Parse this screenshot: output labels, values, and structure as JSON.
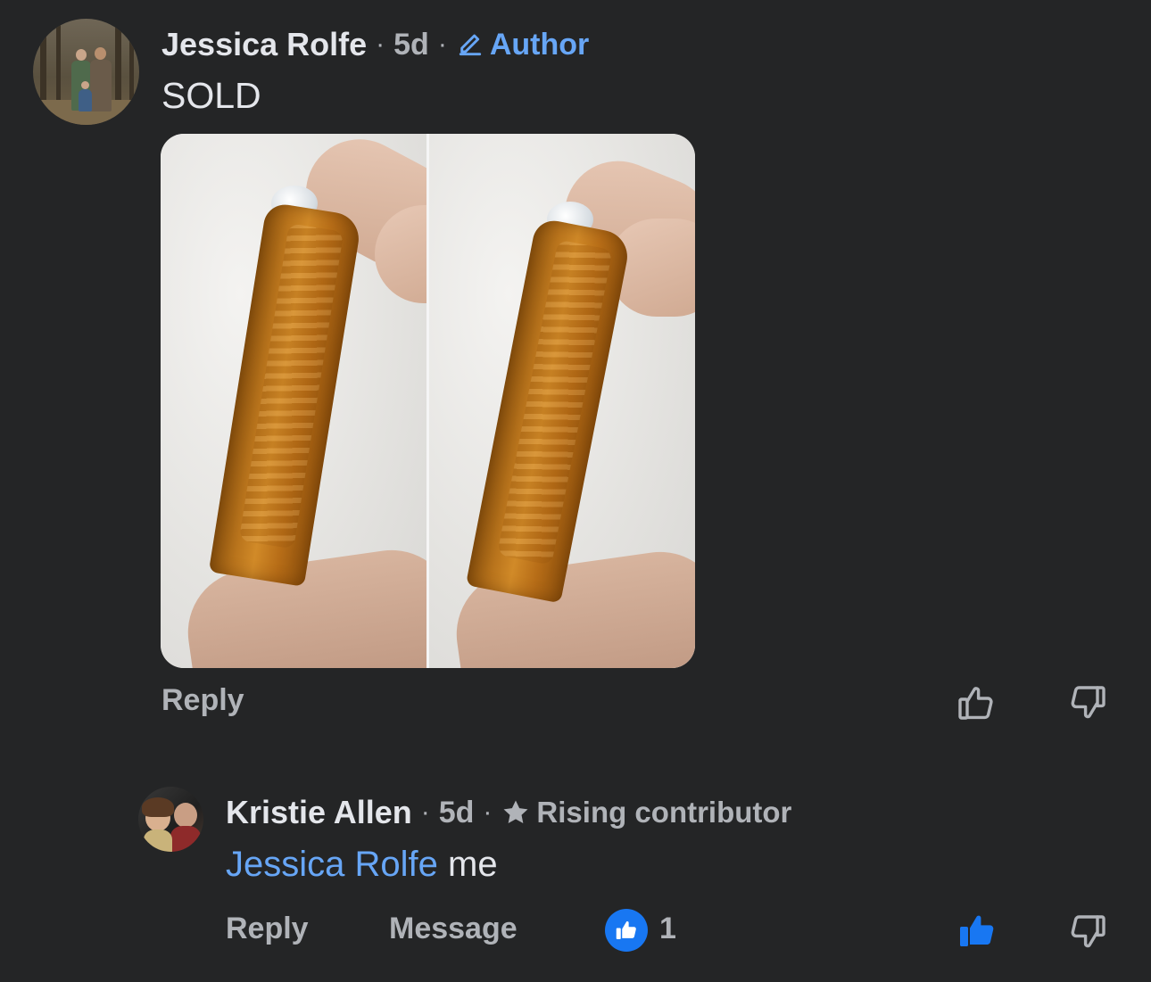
{
  "comments": [
    {
      "author": "Jessica Rolfe",
      "separator": "·",
      "time": "5d",
      "badge": "Author",
      "badge_icon": "pencil-icon",
      "text": "SOLD",
      "attachment": "photo of two views of an orange crystal tower held between fingers",
      "actions": {
        "reply": "Reply"
      },
      "reactions": {
        "liked": false
      }
    },
    {
      "author": "Kristie Allen",
      "separator": "·",
      "time": "5d",
      "badge": "Rising contributor",
      "badge_icon": "star-icon",
      "mention": "Jessica Rolfe",
      "text": "me",
      "actions": {
        "reply": "Reply",
        "message": "Message"
      },
      "reactions": {
        "liked": true,
        "like_count": "1"
      }
    }
  ],
  "colors": {
    "background": "#242526",
    "text_primary": "#e4e6eb",
    "text_secondary": "#b0b3b8",
    "link": "#67a6f6",
    "like_blue": "#1877f2"
  }
}
